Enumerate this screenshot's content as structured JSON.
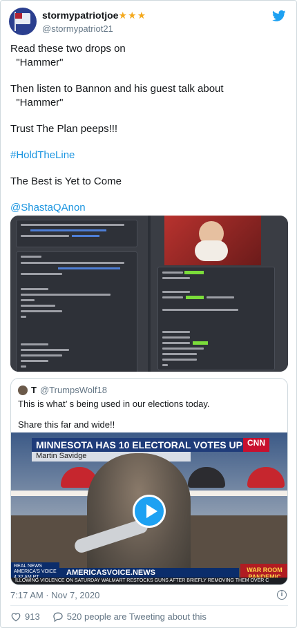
{
  "author": {
    "display_name": "stormypatriotjoe",
    "stars": "★★★",
    "handle": "@stormypatriot21"
  },
  "body": {
    "p1": "Read these two drops on\n  \"Hammer\"",
    "p2": "Then listen to Bannon and his guest talk about\n  \"Hammer\"",
    "p3": "Trust The Plan peeps!!!",
    "hashtag": "#HoldTheLine",
    "p4": "The Best is Yet to Come",
    "mention": "@ShastaQAnon"
  },
  "quote": {
    "initial": "T",
    "handle": "@TrumpsWolf18",
    "text1": "This is what’  s being used in our elections today.",
    "text2": "Share this far and wide!!"
  },
  "video": {
    "banner": "MINNESOTA HAS 10 ELECTORAL VOTES UP FOR GRABS",
    "sub": "Martin Savidge",
    "network": "CNN",
    "ticker_main": "AMERICASVOICE.NEWS",
    "ticker_left": "REAL NEWS AMERICA'S VOICE 4:32 AM PT",
    "ticker_right": "WAR ROOM PANDEMIC",
    "ticker_bottom": "ILLOWING VIOLENCE ON SATURDAY    WALMART RESTOCKS GUNS AFTER BRIEFLY REMOVING THEM OVER C"
  },
  "timestamp": "7:17 AM · Nov 7, 2020",
  "likes": "913",
  "tweeting_about": "520 people are Tweeting about this",
  "colors": {
    "accent": "#1da1f2",
    "link": "#1b95e0",
    "muted": "#657786",
    "like": "#e0245e"
  }
}
